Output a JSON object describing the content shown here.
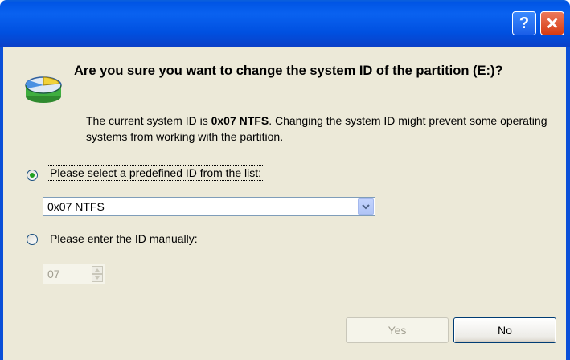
{
  "dialog": {
    "help_symbol": "?",
    "close_symbol": "✕",
    "icon": "partition-disk-icon"
  },
  "message": {
    "question": "Are you sure you want to change the system ID of the partition (E:)?",
    "desc_prefix": "The current system ID is ",
    "current_id": "0x07 NTFS",
    "desc_suffix": ". Changing the system ID might prevent some operating systems from working with the partition."
  },
  "options": {
    "predefined_label": "Please select a predefined ID from the list:",
    "predefined_selected": true,
    "predefined_value": "0x07 NTFS",
    "manual_label": "Please enter the ID manually:",
    "manual_selected": false,
    "manual_value": "07"
  },
  "buttons": {
    "yes_label": "Yes",
    "no_label": "No"
  },
  "colors": {
    "titlebar": "#0055e5",
    "client": "#ece9d8",
    "radio_dot": "#21a121",
    "disabled_text": "#a19e90"
  }
}
